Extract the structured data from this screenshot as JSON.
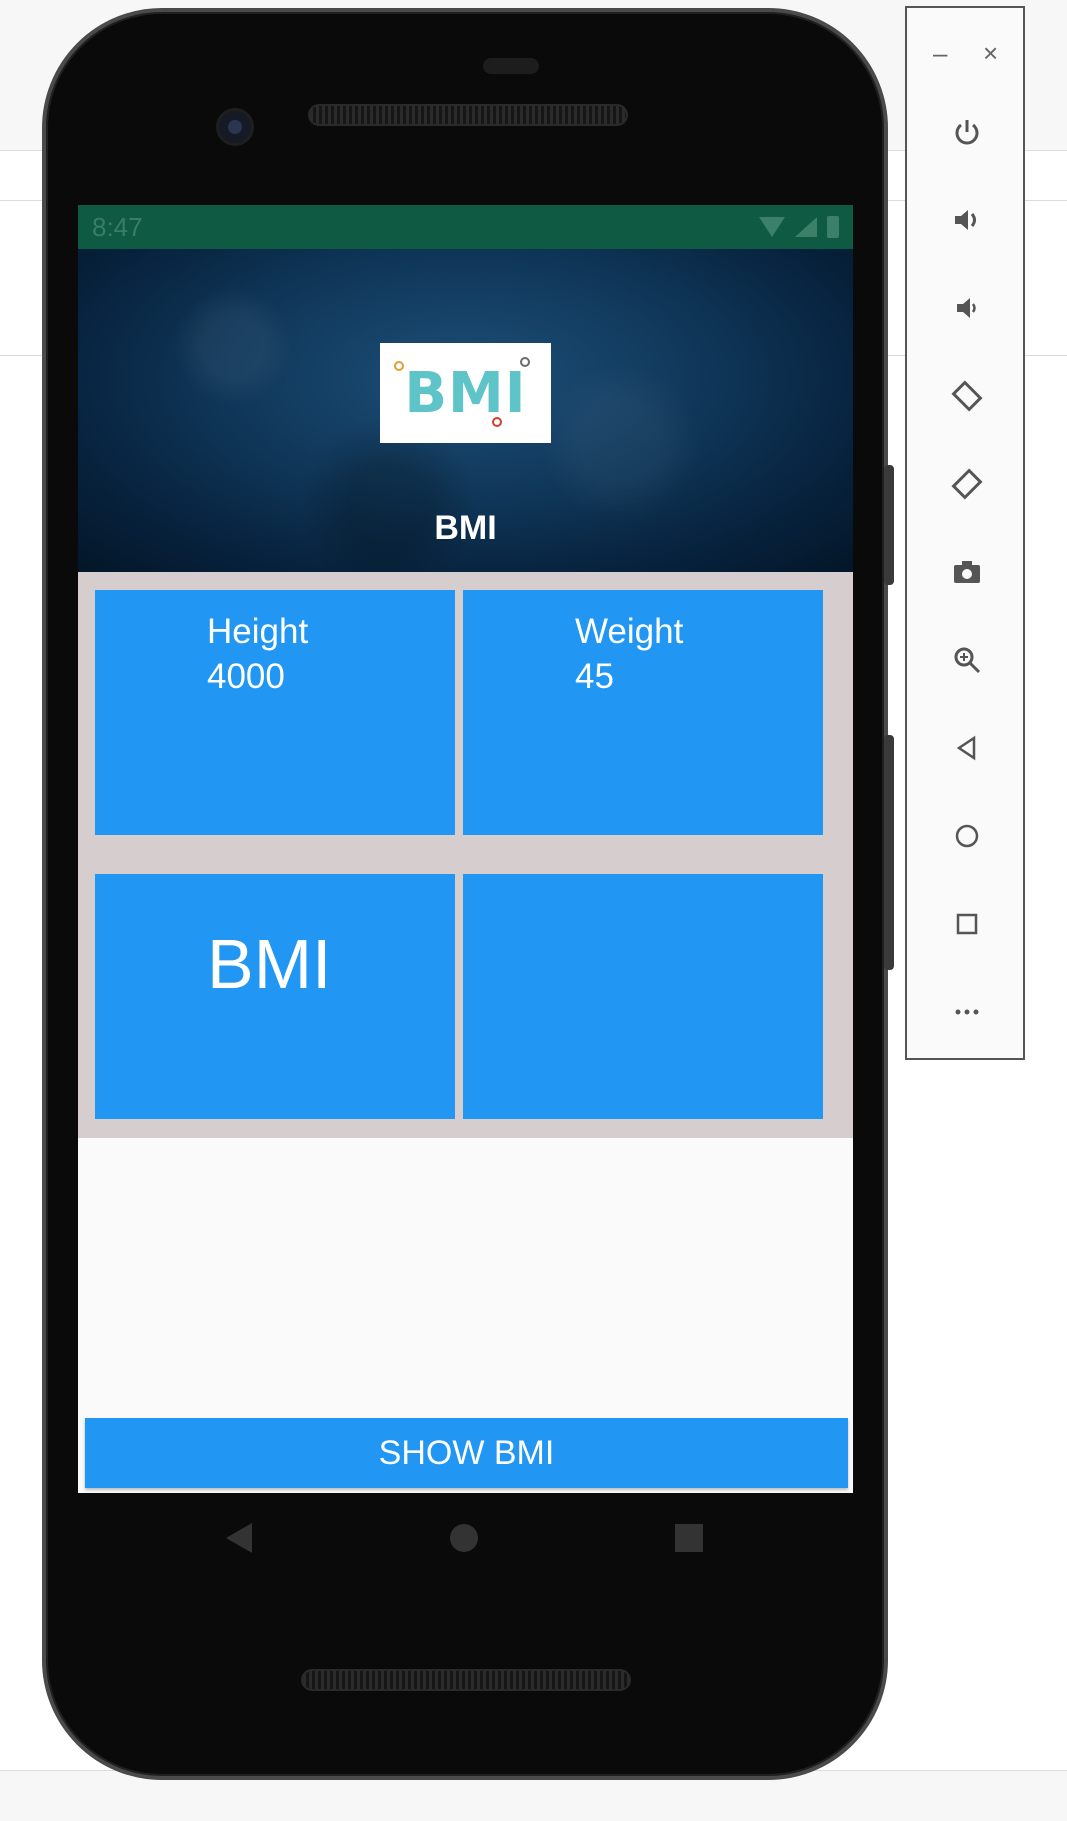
{
  "status_bar": {
    "time": "8:47"
  },
  "app": {
    "logo_text": "BMI",
    "header_title": "BMI",
    "tiles": {
      "height": {
        "label": "Height",
        "value": "4000"
      },
      "weight": {
        "label": "Weight",
        "value": "45"
      },
      "bmi": {
        "label": "BMI"
      }
    },
    "show_button": "SHOW BMI"
  },
  "emulator_toolbar": {
    "minimize": "–",
    "close": "×",
    "buttons": [
      "power-icon",
      "volume-up-icon",
      "volume-down-icon",
      "rotate-left-icon",
      "rotate-right-icon",
      "camera-icon",
      "zoom-icon",
      "back-icon",
      "home-icon",
      "overview-icon",
      "more-icon"
    ]
  },
  "colors": {
    "status_bar": "#0f5a43",
    "tile": "#2196f3",
    "grid_bg": "#d6cece",
    "button": "#2196f3"
  }
}
